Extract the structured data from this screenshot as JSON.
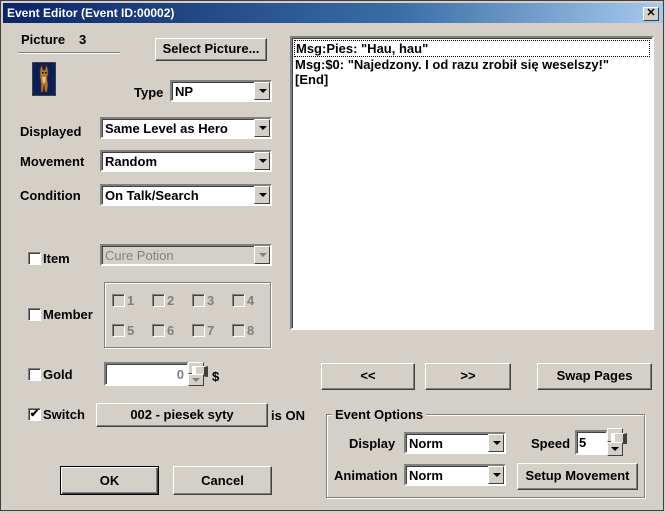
{
  "window": {
    "title": "Event Editor (Event ID:00002)",
    "close_glyph": "✕"
  },
  "picture": {
    "label": "Picture",
    "number": "3",
    "select_button": "Select Picture..."
  },
  "type": {
    "label": "Type",
    "value": "NP"
  },
  "displayed": {
    "label": "Displayed",
    "value": "Same Level as Hero"
  },
  "movement": {
    "label": "Movement",
    "value": "Random"
  },
  "condition": {
    "label": "Condition",
    "value": "On Talk/Search"
  },
  "item": {
    "label": "Item",
    "checked": false,
    "value": "Cure Potion"
  },
  "member": {
    "label": "Member",
    "checked": false,
    "slots": [
      "1",
      "2",
      "3",
      "4",
      "5",
      "6",
      "7",
      "8"
    ]
  },
  "gold": {
    "label": "Gold",
    "checked": false,
    "value": "0",
    "unit": "$"
  },
  "switch": {
    "label": "Switch",
    "checked": true,
    "check_glyph": "✔",
    "value": "002 - piesek syty",
    "suffix": "is ON"
  },
  "script": {
    "lines": [
      "Msg:Pies: \"Hau, hau\"",
      "Msg:$0: \"Najedzony. I od razu zrobił się weselszy!\"",
      "[End]"
    ]
  },
  "pager": {
    "prev": "<<",
    "next": ">>",
    "swap": "Swap Pages"
  },
  "event_options": {
    "title": "Event Options",
    "display_label": "Display",
    "display_value": "Norm",
    "speed_label": "Speed",
    "speed_value": "5",
    "animation_label": "Animation",
    "animation_value": "Norm",
    "setup_movement": "Setup Movement"
  },
  "footer": {
    "ok": "OK",
    "cancel": "Cancel"
  },
  "colors": {
    "titlebar": "#0a246a",
    "face": "#d4d0c8",
    "disabled": "#808080"
  },
  "icons": {
    "sprite": "npc-dog-sprite-icon",
    "dropdown": "chevron-down-icon"
  }
}
